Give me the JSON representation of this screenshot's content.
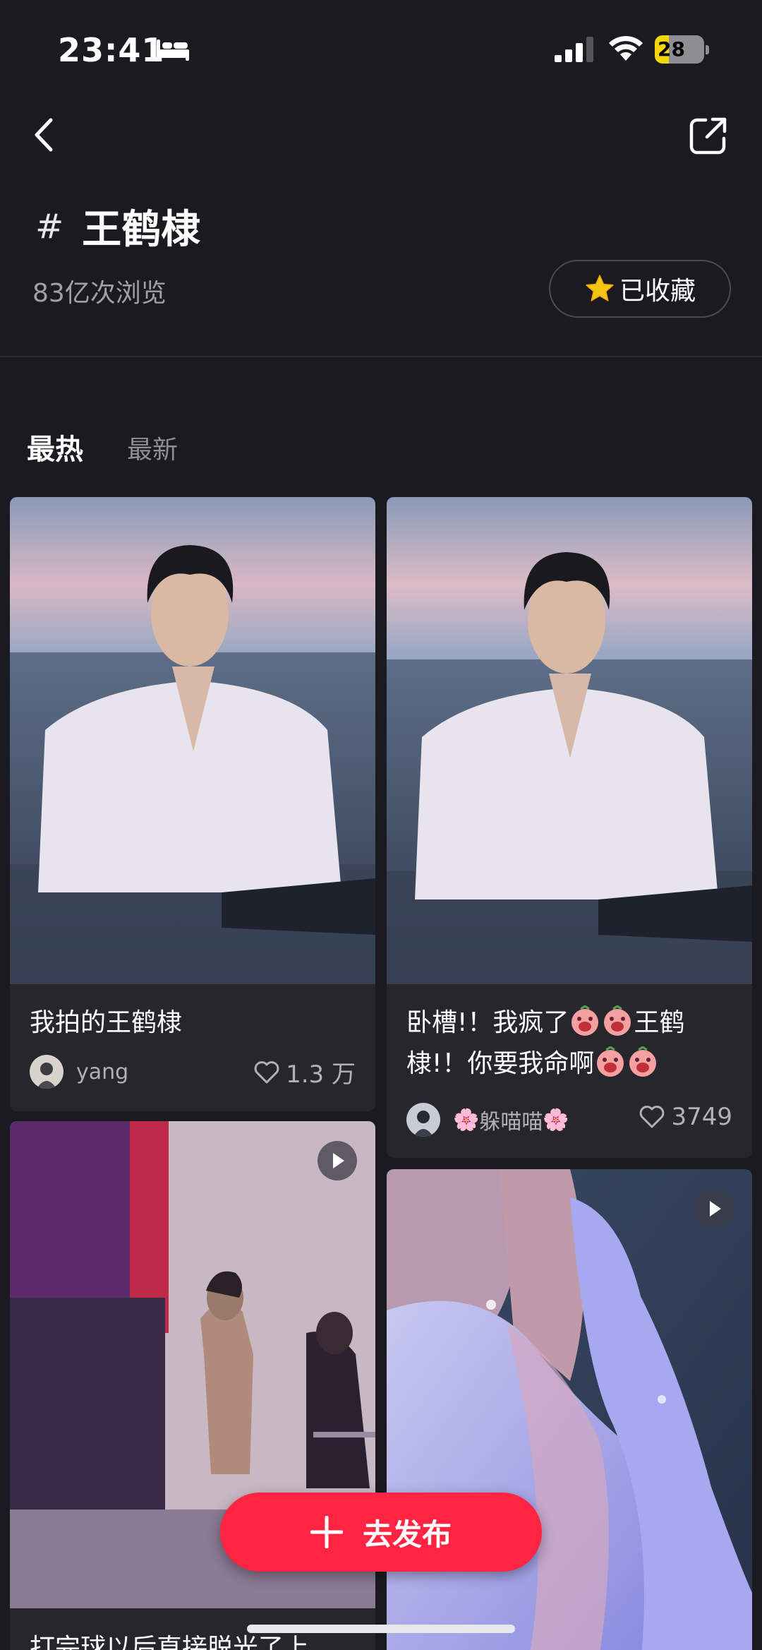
{
  "status_bar": {
    "time": "23:41",
    "battery": "28",
    "battery_level": 0.28
  },
  "topic": {
    "title": "王鹤棣",
    "views": "83亿次浏览",
    "fav_label": "已收藏"
  },
  "tabs": [
    {
      "label": "最热",
      "active": true
    },
    {
      "label": "最新",
      "active": false
    }
  ],
  "cards": [
    {
      "title": "我拍的王鹤棣",
      "author": "yang",
      "likes": "1.3 万",
      "is_video": false
    },
    {
      "title_line1": "卧槽!！我疯了",
      "title_line1b": "王鹤",
      "title_line2": "棣!！你要我命啊",
      "author_prefix": "🌸",
      "author": "躲喵喵",
      "author_suffix": "🌸",
      "likes": "3749",
      "is_video": false
    },
    {
      "title": "打完球以后直接脱光了上",
      "is_video": true
    },
    {
      "title": "",
      "is_video": true
    }
  ],
  "publish": {
    "label": "去发布"
  },
  "colors": {
    "accent": "#ff2442",
    "background": "#1a1a20",
    "card": "#26262c",
    "star": "#f5c518"
  }
}
